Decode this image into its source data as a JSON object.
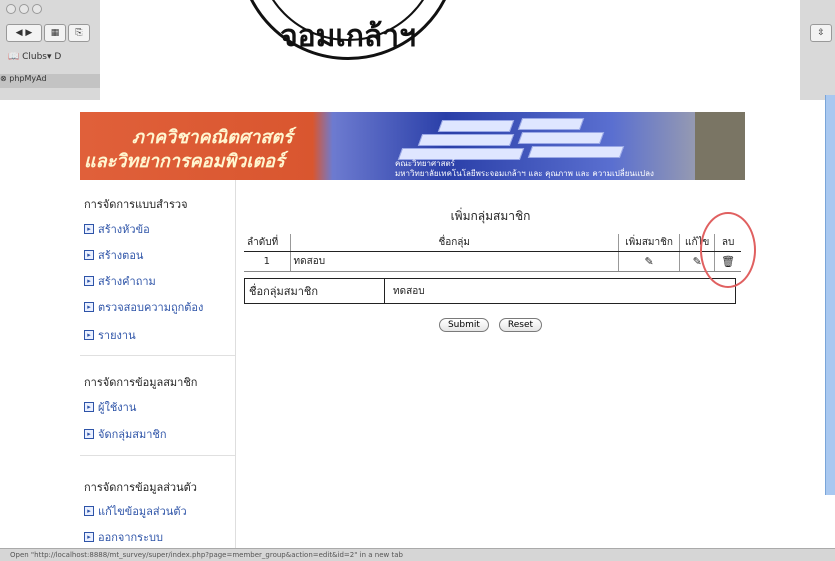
{
  "browser": {
    "bookmarks_label": "Clubs▾",
    "bookmarks_d": "D",
    "tab_label": "phpMyAd"
  },
  "stamp": {
    "text": "จอมเกล้าฯ"
  },
  "banner": {
    "title_line1": "ภาควิชาคณิตศาสตร์",
    "title_line2": "และวิทยาการคอมพิวเตอร์",
    "caption_line1": "คณะวิทยาศาสตร์",
    "caption_line2": "มหาวิทยาลัยเทคโนโลยีพระจอมเกล้าฯ และ คุณภาพ และ ความเปลี่ยนแปลง"
  },
  "sidebar": {
    "sections": [
      {
        "title": "การจัดการแบบสำรวจ",
        "items": [
          "สร้างหัวข้อ",
          "สร้างตอน",
          "สร้างคำถาม",
          "ตรวจสอบความถูกต้อง",
          "รายงาน"
        ]
      },
      {
        "title": "การจัดการข้อมูลสมาชิก",
        "items": [
          "ผู้ใช้งาน",
          "จัดกลุ่มสมาชิก"
        ]
      },
      {
        "title": "การจัดการข้อมูลส่วนตัว",
        "items": [
          "แก้ไขข้อมูลส่วนตัว",
          "ออกจากระบบ"
        ]
      }
    ]
  },
  "main": {
    "page_title": "เพิ่มกลุ่มสมาชิก",
    "table": {
      "headers": [
        "ลำดับที่",
        "ชื่อกลุ่ม",
        "เพิ่มสมาชิก",
        "แก้ไข",
        "ลบ"
      ],
      "rows": [
        {
          "no": "1",
          "name": "ทดสอบ"
        }
      ]
    },
    "form": {
      "label": "ชื่อกลุ่มสมาชิก",
      "value": "ทดสอบ"
    },
    "submit_label": "Submit",
    "reset_label": "Reset"
  },
  "icons": {
    "add_member": "edit-note-icon",
    "edit": "edit-note-icon",
    "delete": "trash-icon"
  },
  "colors": {
    "link": "#2e54a8",
    "banner_orange": "#e0603a",
    "banner_blue": "#2a3fa8",
    "annotation_red": "#e06060"
  },
  "status_bar": "Open \"http://localhost:8888/mt_survey/super/index.php?page=member_group&action=edit&id=2\" in a new tab"
}
